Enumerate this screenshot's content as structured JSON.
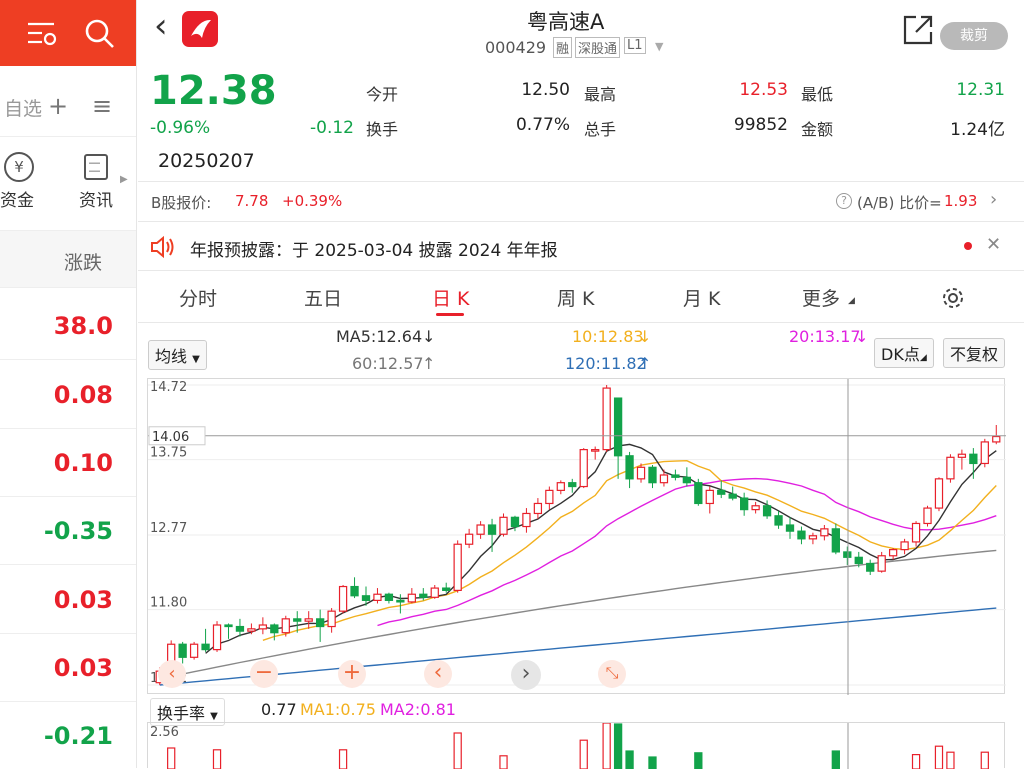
{
  "left": {
    "menu_label": "自选",
    "quick": [
      {
        "icon": "money-icon",
        "label": "资金"
      },
      {
        "icon": "news-icon",
        "label": "资讯"
      }
    ],
    "column_header": "涨跌",
    "rows": [
      "38.0",
      "0.08",
      "0.10",
      "-0.35",
      "0.03",
      "0.03",
      "-0.21"
    ]
  },
  "header": {
    "title": "粤高速A",
    "code": "000429",
    "badges": [
      "融",
      "深股通",
      "L1"
    ],
    "crop_label": "裁剪"
  },
  "quote": {
    "price": "12.38",
    "change_pct": "-0.96%",
    "change": "-0.12",
    "date": "20250207",
    "open_label": "今开",
    "open": "12.50",
    "high_label": "最高",
    "high": "12.53",
    "low_label": "最低",
    "low": "12.31",
    "turnover_label": "换手",
    "turnover": "0.77%",
    "volume_label": "总手",
    "volume": "99852",
    "amount_label": "金额",
    "amount": "1.24亿"
  },
  "bshare": {
    "label": "B股报价:",
    "price": "7.78",
    "change": "+0.39%",
    "ratio_label": "(A/B) 比价=",
    "ratio": "1.93"
  },
  "notice": {
    "text": "年报预披露：于 2025-03-04 披露 2024 年年报"
  },
  "tabs": [
    "分时",
    "五日",
    "日 K",
    "周 K",
    "月 K",
    "更多"
  ],
  "indicators": {
    "type_label": "均线",
    "ma5": "MA5:12.64",
    "ma10": "10:12.83",
    "ma20": "20:13.17",
    "ma60": "60:12.57",
    "ma120": "120:11.82",
    "dk_label": "DK点",
    "fq_label": "不复权"
  },
  "chart_data": {
    "type": "candlestick",
    "y_ticks": [
      "14.72",
      "13.75",
      "12.77",
      "11.80",
      "10.82"
    ],
    "ylim": [
      10.82,
      14.72
    ],
    "crosshair_price": "14.06",
    "colors": {
      "up": "#e8202a",
      "down": "#12a34a",
      "ma5": "#333333",
      "ma10": "#f2b01e",
      "ma20": "#e020e0",
      "ma60": "#888888",
      "ma120": "#2f6fb5"
    },
    "candles": [
      [
        10.85,
        11.05,
        10.82,
        11.0
      ],
      [
        11.0,
        11.4,
        10.98,
        11.35
      ],
      [
        11.35,
        11.38,
        11.1,
        11.18
      ],
      [
        11.18,
        11.38,
        11.15,
        11.35
      ],
      [
        11.35,
        11.55,
        11.25,
        11.28
      ],
      [
        11.28,
        11.65,
        11.25,
        11.6
      ],
      [
        11.6,
        11.62,
        11.42,
        11.58
      ],
      [
        11.58,
        11.68,
        11.45,
        11.52
      ],
      [
        11.52,
        11.62,
        11.48,
        11.55
      ],
      [
        11.55,
        11.7,
        11.48,
        11.6
      ],
      [
        11.6,
        11.62,
        11.4,
        11.5
      ],
      [
        11.5,
        11.72,
        11.45,
        11.68
      ],
      [
        11.68,
        11.78,
        11.5,
        11.65
      ],
      [
        11.65,
        11.78,
        11.55,
        11.68
      ],
      [
        11.68,
        11.8,
        11.38,
        11.58
      ],
      [
        11.58,
        11.82,
        11.5,
        11.78
      ],
      [
        11.78,
        12.12,
        11.75,
        12.1
      ],
      [
        12.1,
        12.22,
        11.95,
        11.98
      ],
      [
        11.98,
        12.1,
        11.85,
        11.92
      ],
      [
        11.92,
        12.08,
        11.88,
        12.0
      ],
      [
        12.0,
        12.02,
        11.88,
        11.92
      ],
      [
        11.92,
        12.0,
        11.75,
        11.9
      ],
      [
        11.9,
        12.08,
        11.88,
        12.0
      ],
      [
        12.0,
        12.08,
        11.92,
        11.96
      ],
      [
        11.96,
        12.12,
        11.94,
        12.08
      ],
      [
        12.08,
        12.15,
        12.02,
        12.05
      ],
      [
        12.05,
        12.7,
        12.02,
        12.65
      ],
      [
        12.65,
        12.85,
        12.6,
        12.78
      ],
      [
        12.78,
        12.95,
        12.72,
        12.9
      ],
      [
        12.9,
        12.98,
        12.55,
        12.78
      ],
      [
        12.78,
        13.05,
        12.75,
        13.0
      ],
      [
        13.0,
        13.02,
        12.82,
        12.88
      ],
      [
        12.88,
        13.12,
        12.8,
        13.05
      ],
      [
        13.05,
        13.25,
        12.98,
        13.18
      ],
      [
        13.18,
        13.4,
        13.1,
        13.35
      ],
      [
        13.35,
        13.48,
        13.3,
        13.45
      ],
      [
        13.45,
        13.5,
        13.32,
        13.4
      ],
      [
        13.4,
        13.9,
        13.38,
        13.88
      ],
      [
        13.88,
        13.92,
        13.75,
        13.88
      ],
      [
        13.88,
        14.72,
        13.85,
        14.68
      ],
      [
        14.55,
        14.55,
        13.5,
        13.8
      ],
      [
        13.8,
        13.85,
        13.38,
        13.5
      ],
      [
        13.5,
        13.7,
        13.45,
        13.65
      ],
      [
        13.65,
        13.68,
        13.38,
        13.45
      ],
      [
        13.45,
        13.62,
        13.4,
        13.55
      ],
      [
        13.55,
        13.62,
        13.48,
        13.52
      ],
      [
        13.52,
        13.65,
        13.4,
        13.45
      ],
      [
        13.45,
        13.5,
        13.15,
        13.18
      ],
      [
        13.18,
        13.4,
        13.05,
        13.35
      ],
      [
        13.35,
        13.48,
        13.25,
        13.3
      ],
      [
        13.3,
        13.4,
        13.22,
        13.25
      ],
      [
        13.25,
        13.32,
        13.02,
        13.1
      ],
      [
        13.1,
        13.2,
        13.05,
        13.15
      ],
      [
        13.15,
        13.22,
        12.98,
        13.02
      ],
      [
        13.02,
        13.08,
        12.85,
        12.9
      ],
      [
        12.9,
        13.0,
        12.72,
        12.82
      ],
      [
        12.82,
        12.88,
        12.65,
        12.72
      ],
      [
        12.72,
        12.8,
        12.65,
        12.76
      ],
      [
        12.76,
        12.9,
        12.7,
        12.85
      ],
      [
        12.85,
        12.92,
        12.52,
        12.55
      ],
      [
        12.55,
        12.62,
        12.38,
        12.48
      ],
      [
        12.48,
        12.55,
        12.35,
        12.4
      ],
      [
        12.4,
        12.45,
        12.25,
        12.3
      ],
      [
        12.3,
        12.55,
        12.28,
        12.5
      ],
      [
        12.5,
        12.6,
        12.45,
        12.58
      ],
      [
        12.58,
        12.72,
        12.52,
        12.68
      ],
      [
        12.68,
        12.95,
        12.62,
        12.92
      ],
      [
        12.92,
        13.15,
        12.88,
        13.12
      ],
      [
        13.12,
        13.52,
        13.08,
        13.5
      ],
      [
        13.5,
        13.82,
        13.45,
        13.78
      ],
      [
        13.78,
        13.88,
        13.62,
        13.82
      ],
      [
        13.82,
        13.9,
        13.5,
        13.7
      ],
      [
        13.7,
        14.02,
        13.65,
        13.98
      ],
      [
        13.98,
        14.2,
        13.95,
        14.05
      ]
    ]
  },
  "turnover_panel": {
    "type_label": "换手率",
    "value": "0.77",
    "ma1": "MA1:0.75",
    "ma2": "MA2:0.81",
    "y_top": "2.56"
  }
}
